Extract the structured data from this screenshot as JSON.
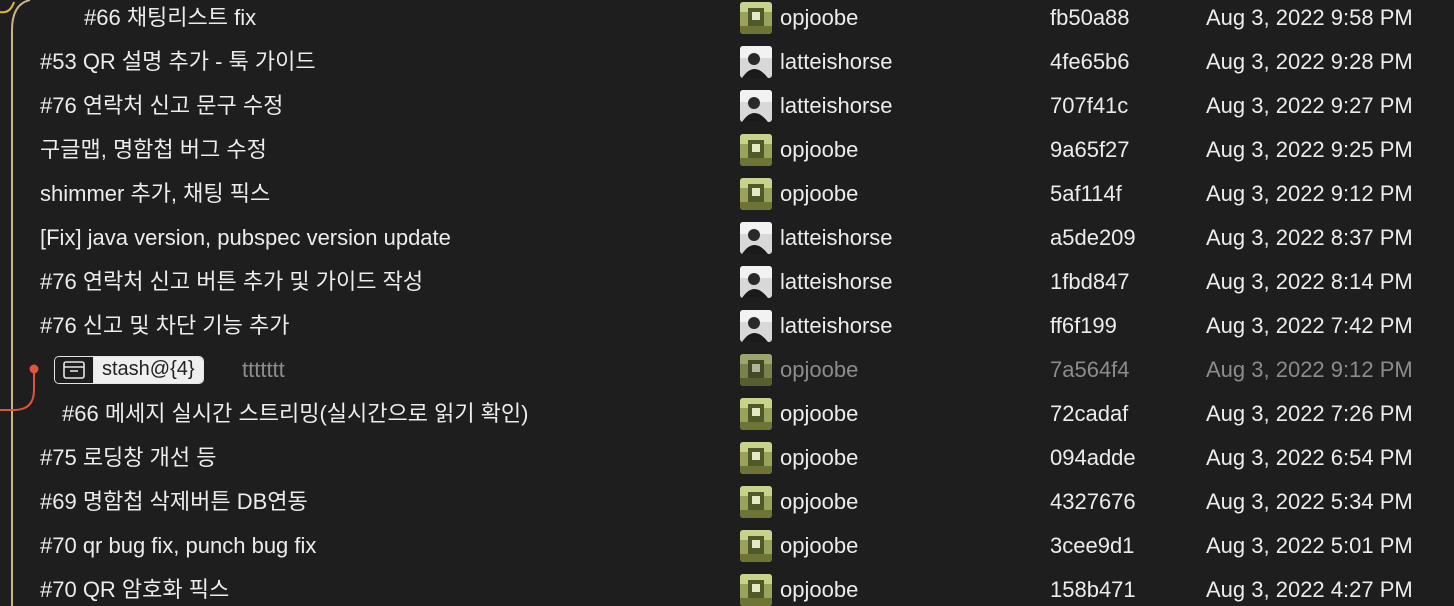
{
  "stash_row": {
    "tag": "stash@{4}",
    "message": "ttttttt",
    "author": "opjoobe",
    "hash": "7a564f4",
    "date": "Aug 3, 2022 9:12 PM"
  },
  "commits": [
    {
      "message": "#66 채팅리스트 fix",
      "author": "opjoobe",
      "avatar": "opjoobe-avatar",
      "hash": "fb50a88",
      "date": "Aug 3, 2022 9:58 PM"
    },
    {
      "message": "#53 QR 설명 추가 - 툭 가이드",
      "author": "latteishorse",
      "avatar": "latteishorse-avatar",
      "hash": "4fe65b6",
      "date": "Aug 3, 2022 9:28 PM"
    },
    {
      "message": "#76 연락처 신고 문구 수정",
      "author": "latteishorse",
      "avatar": "latteishorse-avatar",
      "hash": "707f41c",
      "date": "Aug 3, 2022 9:27 PM"
    },
    {
      "message": "구글맵, 명함첩 버그 수정",
      "author": "opjoobe",
      "avatar": "opjoobe-avatar",
      "hash": "9a65f27",
      "date": "Aug 3, 2022 9:25 PM"
    },
    {
      "message": "shimmer 추가, 채팅 픽스",
      "author": "opjoobe",
      "avatar": "opjoobe-avatar",
      "hash": "5af114f",
      "date": "Aug 3, 2022 9:12 PM"
    },
    {
      "message": "[Fix] java version, pubspec version update",
      "author": "latteishorse",
      "avatar": "latteishorse-avatar",
      "hash": "a5de209",
      "date": "Aug 3, 2022 8:37 PM"
    },
    {
      "message": "#76 연락처 신고 버튼 추가 및 가이드 작성",
      "author": "latteishorse",
      "avatar": "latteishorse-avatar",
      "hash": "1fbd847",
      "date": "Aug 3, 2022 8:14 PM"
    },
    {
      "message": "#76 신고 및 차단 기능 추가",
      "author": "latteishorse",
      "avatar": "latteishorse-avatar",
      "hash": "ff6f199",
      "date": "Aug 3, 2022 7:42 PM"
    },
    {
      "message": "#66 메세지 실시간 스트리밍(실시간으로 읽기 확인)",
      "author": "opjoobe",
      "avatar": "opjoobe-avatar",
      "hash": "72cadaf",
      "date": "Aug 3, 2022 7:26 PM"
    },
    {
      "message": "#75 로딩창 개선 등",
      "author": "opjoobe",
      "avatar": "opjoobe-avatar",
      "hash": "094adde",
      "date": "Aug 3, 2022 6:54 PM"
    },
    {
      "message": "#69 명함첩 삭제버튼 DB연동",
      "author": "opjoobe",
      "avatar": "opjoobe-avatar",
      "hash": "4327676",
      "date": "Aug 3, 2022 5:34 PM"
    },
    {
      "message": "#70 qr bug fix, punch bug fix",
      "author": "opjoobe",
      "avatar": "opjoobe-avatar",
      "hash": "3cee9d1",
      "date": "Aug 3, 2022 5:01 PM"
    },
    {
      "message": "#70 QR 암호화 픽스",
      "author": "opjoobe",
      "avatar": "opjoobe-avatar",
      "hash": "158b471",
      "date": "Aug 3, 2022 4:27 PM"
    }
  ],
  "colors": {
    "background": "#1e1e1e",
    "text": "#ececec",
    "muted_text": "#8c8c8c",
    "branch_main": "#c9b48a",
    "branch_stash": "#e0533c",
    "branch_top": "#e8b33a"
  },
  "icons": {
    "stash": "stash-box-icon"
  }
}
